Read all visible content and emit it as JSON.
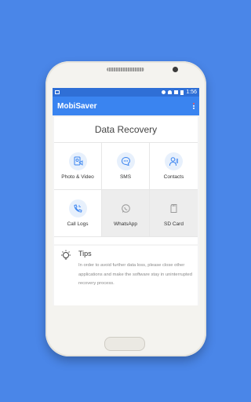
{
  "status_bar": {
    "time": "1:56"
  },
  "app": {
    "title": "MobiSaver"
  },
  "card": {
    "title": "Data Recovery",
    "items": [
      {
        "label": "Photo & Video",
        "icon": "photo-video-icon",
        "enabled": true
      },
      {
        "label": "SMS",
        "icon": "sms-icon",
        "enabled": true
      },
      {
        "label": "Contacts",
        "icon": "contacts-icon",
        "enabled": true
      },
      {
        "label": "Call Logs",
        "icon": "call-logs-icon",
        "enabled": true
      },
      {
        "label": "WhatsApp",
        "icon": "whatsapp-icon",
        "enabled": false
      },
      {
        "label": "SD Card",
        "icon": "sd-card-icon",
        "enabled": false
      }
    ]
  },
  "tips": {
    "title": "Tips",
    "text": "In order to avoid further data loss, please close other applications and make the software stay in uninterrupted recovery process."
  },
  "colors": {
    "background": "#4a86e8",
    "appbar": "#3a84f0",
    "statusbar": "#2f6fd6",
    "icon_blue": "#3a84f0"
  }
}
